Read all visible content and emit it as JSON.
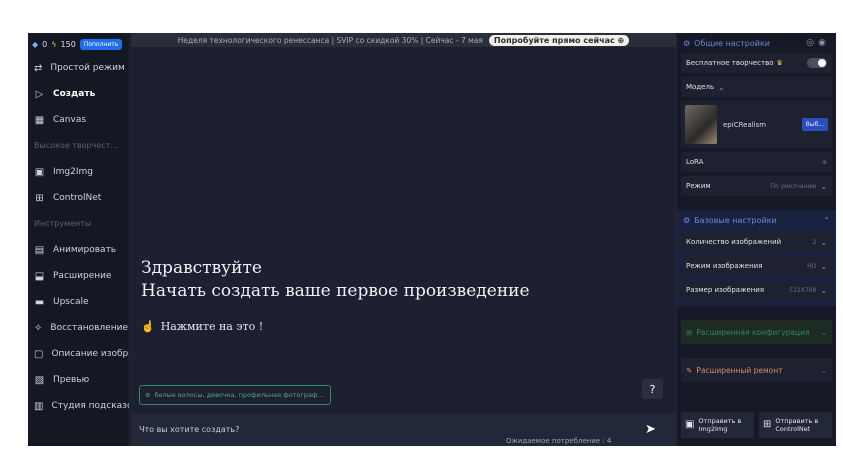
{
  "topbar": {
    "coins": "0",
    "credits": "150",
    "topup_label": "Пополнить"
  },
  "sidebar": {
    "items": [
      {
        "label": "Простой режим",
        "icon": "⇄",
        "icon_name": "simple-mode-icon"
      },
      {
        "label": "Создать",
        "icon": "▷",
        "icon_name": "create-icon",
        "active": true
      },
      {
        "label": "Canvas",
        "icon": "▦",
        "icon_name": "canvas-icon"
      }
    ],
    "section_creative": "Высокое творчест...",
    "items2": [
      {
        "label": "Img2Img",
        "icon": "▣",
        "icon_name": "img2img-icon"
      },
      {
        "label": "ControlNet",
        "icon": "⊞",
        "icon_name": "controlnet-icon"
      }
    ],
    "section_tools": "Инструменты",
    "items3": [
      {
        "label": "Анимировать",
        "icon": "▤",
        "icon_name": "animate-icon"
      },
      {
        "label": "Расширение",
        "icon": "⬓",
        "icon_name": "expand-icon"
      },
      {
        "label": "Upscale",
        "icon": "▬",
        "icon_name": "upscale-icon"
      },
      {
        "label": "Восстановление ре",
        "icon": "✧",
        "icon_name": "restore-icon"
      },
      {
        "label": "Описание изображ",
        "icon": "▢",
        "icon_name": "describe-image-icon"
      },
      {
        "label": "Превью",
        "icon": "▧",
        "icon_name": "preview-icon"
      },
      {
        "label": "Студия подсказок",
        "icon": "▥",
        "icon_name": "prompt-studio-icon"
      }
    ]
  },
  "main": {
    "banner_text": "Неделя технологического ренессанса | SVIP со скидкой 30% | Сейчас - 7 мая",
    "banner_cta": "Попробуйте прямо сейчас ⊕",
    "greeting_line1": "Здравствуйте",
    "greeting_line2": "Начать создать ваше первое произведение",
    "click_hint": "Нажмите на это !",
    "suggestion": "белые волосы, девочка, профильная фотограф...",
    "help": "?",
    "prompt_placeholder": "Что вы хотите создать?",
    "queue_text": "Ожидаемое потребление : 4"
  },
  "right": {
    "general_title": "Общие настройки",
    "free_creative_label": "Бесплатное творчество",
    "model_label": "Модель",
    "model_name": "epiCRealism",
    "choose_label": "Выб...",
    "lora_label": "LoRA",
    "mode_label": "Режим",
    "mode_value": "По умолчанию",
    "basic_title": "Базовые настройки",
    "count_label": "Количество изображений",
    "count_value": "2",
    "image_mode_label": "Режим изображения",
    "image_mode_value": "HD",
    "size_label": "Размер изображения",
    "size_value": "512X768",
    "advanced_title": "Расширенная конфигурация",
    "repair_title": "Расширенный ремонт",
    "send_img2img": "Отправить в Img2Img",
    "send_controlnet": "Отправить в ControlNet"
  }
}
